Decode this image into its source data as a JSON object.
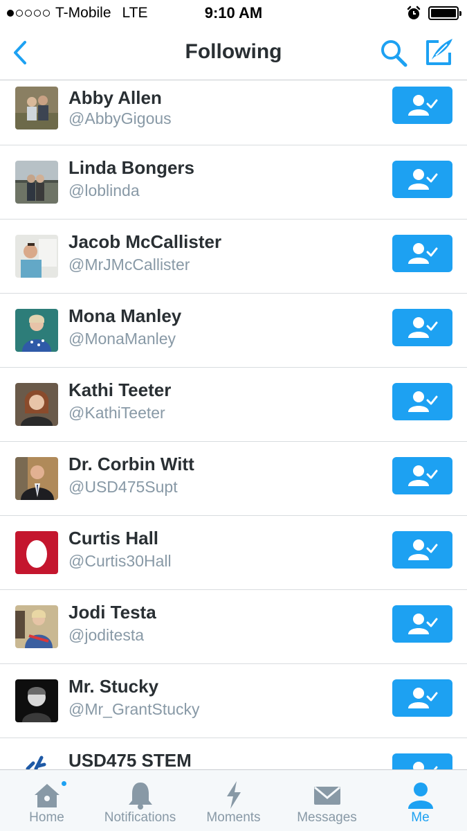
{
  "status_bar": {
    "carrier": "T-Mobile",
    "network": "LTE",
    "time": "9:10 AM"
  },
  "nav": {
    "title": "Following"
  },
  "accounts": [
    {
      "name": "Abby Allen",
      "handle": "@AbbyGigous"
    },
    {
      "name": "Linda Bongers",
      "handle": "@loblinda"
    },
    {
      "name": "Jacob McCallister",
      "handle": "@MrJMcCallister"
    },
    {
      "name": "Mona Manley",
      "handle": "@MonaManley"
    },
    {
      "name": "Kathi Teeter",
      "handle": "@KathiTeeter"
    },
    {
      "name": "Dr. Corbin Witt",
      "handle": "@USD475Supt"
    },
    {
      "name": "Curtis Hall",
      "handle": "@Curtis30Hall"
    },
    {
      "name": "Jodi Testa",
      "handle": "@joditesta"
    },
    {
      "name": "Mr. Stucky",
      "handle": "@Mr_GrantStucky"
    },
    {
      "name": "USD475 STEM",
      "handle": ""
    }
  ],
  "tabs": [
    {
      "label": "Home",
      "icon": "home-icon"
    },
    {
      "label": "Notifications",
      "icon": "bell-icon"
    },
    {
      "label": "Moments",
      "icon": "lightning-icon"
    },
    {
      "label": "Messages",
      "icon": "envelope-icon"
    },
    {
      "label": "Me",
      "icon": "person-icon"
    }
  ],
  "colors": {
    "accent": "#1da1f2",
    "text": "#292f33",
    "secondary": "#8899a6"
  }
}
